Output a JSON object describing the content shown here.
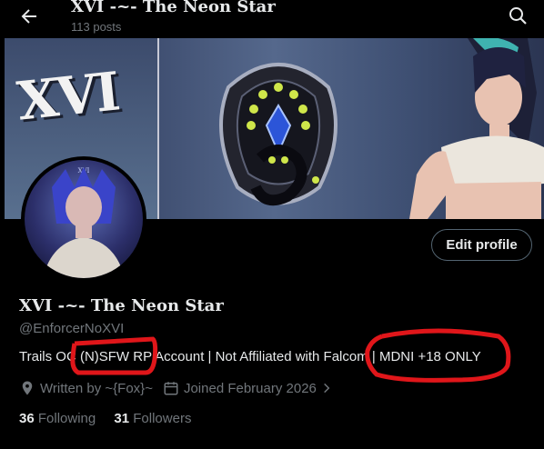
{
  "header": {
    "title": "XVI -~- The Neon Star",
    "post_count": "113 posts"
  },
  "banner": {
    "card_text": "XVI"
  },
  "avatar": {
    "label": "XVI"
  },
  "actions": {
    "edit_profile": "Edit profile"
  },
  "profile": {
    "display_name": "XVI -~- The Neon Star",
    "handle": "@EnforcerNoXVI",
    "bio": "Trails OC (N)SFW RP Account | Not Affiliated with Falcom | MDNI +18 ONLY",
    "location": "Written by ~{Fox}~",
    "joined": "Joined February 2026",
    "following_count": "36",
    "following_label": "Following",
    "followers_count": "31",
    "followers_label": "Followers"
  },
  "colors": {
    "background": "#000000",
    "primary_text": "#e7e9ea",
    "secondary_text": "#71767b",
    "annotation": "#e0161a"
  },
  "icons": [
    "back-arrow-icon",
    "search-icon",
    "location-icon",
    "calendar-icon",
    "chevron-right-icon"
  ]
}
